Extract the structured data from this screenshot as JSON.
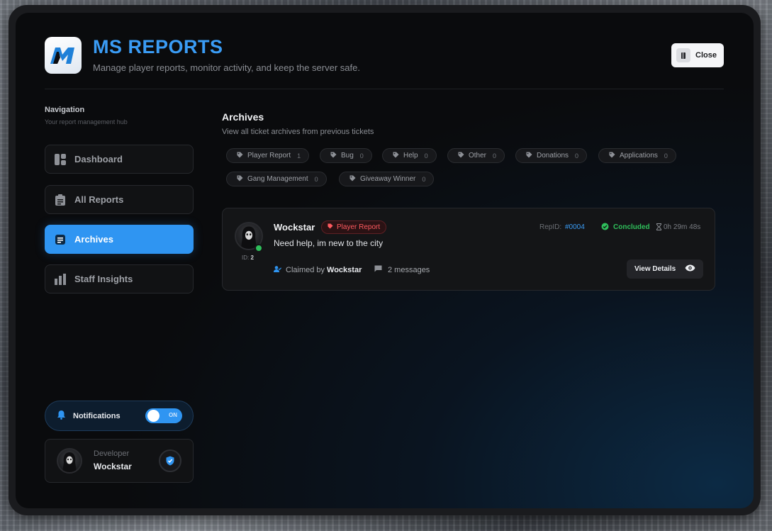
{
  "header": {
    "title": "MS REPORTS",
    "subtitle": "Manage player reports, monitor activity, and keep the server safe.",
    "close_label": "Close"
  },
  "sidebar": {
    "title": "Navigation",
    "subtitle": "Your report management hub",
    "items": [
      {
        "label": "Dashboard",
        "icon": "dashboard-icon",
        "active": false
      },
      {
        "label": "All Reports",
        "icon": "clipboard-icon",
        "active": false
      },
      {
        "label": "Archives",
        "icon": "archive-icon",
        "active": true
      },
      {
        "label": "Staff Insights",
        "icon": "bar-chart-icon",
        "active": false
      }
    ],
    "notifications": {
      "label": "Notifications",
      "toggle_text": "ON",
      "enabled": true
    },
    "profile": {
      "role": "Developer",
      "name": "Wockstar"
    }
  },
  "main": {
    "title": "Archives",
    "subtitle": "View all ticket archives from previous tickets",
    "categories": [
      {
        "label": "Player Report",
        "count": "1"
      },
      {
        "label": "Bug",
        "count": "0"
      },
      {
        "label": "Help",
        "count": "0"
      },
      {
        "label": "Other",
        "count": "0"
      },
      {
        "label": "Donations",
        "count": "0"
      },
      {
        "label": "Applications",
        "count": "0"
      },
      {
        "label": "Gang Management",
        "count": "0"
      },
      {
        "label": "Giveaway Winner",
        "count": "0"
      }
    ],
    "tickets": [
      {
        "player": "Wockstar",
        "id_label": "ID:",
        "id": "2",
        "category": "Player Report",
        "message": "Need help, im new to the city",
        "rep_label": "RepID:",
        "rep_id": "#0004",
        "status": "Concluded",
        "duration": "0h 29m 48s",
        "claimed_label": "Claimed by",
        "claimed_by": "Wockstar",
        "messages": "2 messages",
        "view_label": "View Details"
      }
    ]
  },
  "colors": {
    "accent": "#2f95f2",
    "title": "#3a9cf5",
    "status_green": "#2fbf5b",
    "badge_red": "#ff5a5f"
  }
}
